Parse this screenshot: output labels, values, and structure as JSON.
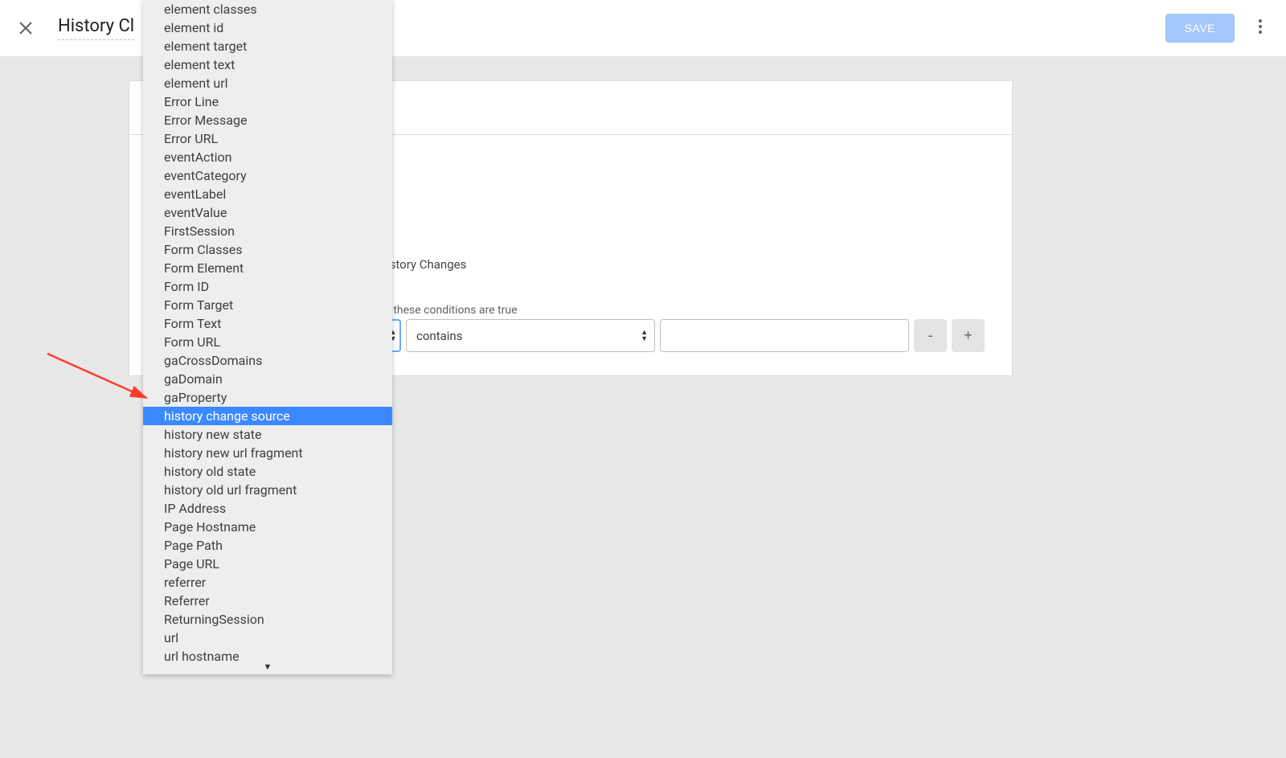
{
  "header": {
    "title": "History Cl",
    "save_label": "SAVE"
  },
  "card": {
    "trigger_type_text": "istory Changes",
    "conditions_hint_text": "f these conditions are true",
    "operator_value": "contains",
    "value_input": "",
    "remove_label": "-",
    "add_label": "+"
  },
  "dropdown": {
    "highlighted_index": 22,
    "items": [
      "element classes",
      "element id",
      "element target",
      "element text",
      "element url",
      "Error Line",
      "Error Message",
      "Error URL",
      "eventAction",
      "eventCategory",
      "eventLabel",
      "eventValue",
      "FirstSession",
      "Form Classes",
      "Form Element",
      "Form ID",
      "Form Target",
      "Form Text",
      "Form URL",
      "gaCrossDomains",
      "gaDomain",
      "gaProperty",
      "history change source",
      "history new state",
      "history new url fragment",
      "history old state",
      "history old url fragment",
      "IP Address",
      "Page Hostname",
      "Page Path",
      "Page URL",
      "referrer",
      "Referrer",
      "ReturningSession",
      "url",
      "url hostname"
    ]
  }
}
